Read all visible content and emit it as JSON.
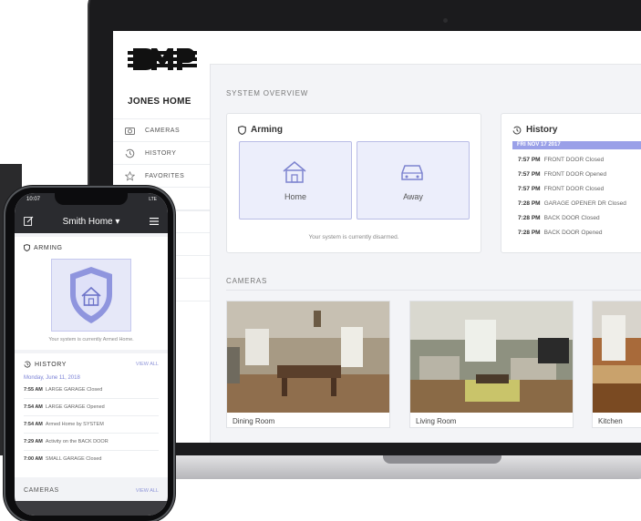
{
  "brand": {
    "logo_text": "DMP"
  },
  "sidebar": {
    "home_name": "JONES HOME",
    "items": [
      {
        "label": "CAMERAS",
        "icon": "camera-icon"
      },
      {
        "label": "HISTORY",
        "icon": "history-icon"
      },
      {
        "label": "FAVORITES",
        "icon": "star-icon"
      }
    ]
  },
  "main": {
    "system_overview_label": "SYSTEM OVERVIEW",
    "arming": {
      "title": "Arming",
      "buttons": [
        {
          "label": "Home",
          "icon": "house-icon"
        },
        {
          "label": "Away",
          "icon": "car-icon"
        }
      ],
      "status": "Your system is currently disarmed."
    },
    "history": {
      "title": "History",
      "date": "FRI NOV 17 2017",
      "events": [
        {
          "time": "7:57 PM",
          "text": "FRONT DOOR Closed"
        },
        {
          "time": "7:57 PM",
          "text": "FRONT DOOR Opened"
        },
        {
          "time": "7:57 PM",
          "text": "FRONT DOOR Closed"
        },
        {
          "time": "7:28 PM",
          "text": "GARAGE OPENER DR Closed"
        },
        {
          "time": "7:28 PM",
          "text": "BACK DOOR Closed"
        },
        {
          "time": "7:28 PM",
          "text": "BACK DOOR Opened"
        }
      ]
    },
    "cameras_label": "CAMERAS",
    "cameras": [
      {
        "name": "Dining Room"
      },
      {
        "name": "Living Room"
      },
      {
        "name": "Kitchen"
      }
    ]
  },
  "phone": {
    "time": "10:07",
    "signal": "LTE",
    "title": "Smith Home ▾",
    "arming_title": "ARMING",
    "arming_status": "Your system is currently Armed Home.",
    "history_title": "HISTORY",
    "view_all": "VIEW ALL",
    "date": "Monday, June 11, 2018",
    "events": [
      {
        "time": "7:55 AM",
        "text": "LARGE GARAGE Closed"
      },
      {
        "time": "7:54 AM",
        "text": "LARGE GARAGE Opened"
      },
      {
        "time": "7:54 AM",
        "text": "Armed Home by SYSTEM"
      },
      {
        "time": "7:29 AM",
        "text": "Activity on the BACK DOOR"
      },
      {
        "time": "7:00 AM",
        "text": "SMALL GARAGE Closed"
      }
    ],
    "cameras_title": "CAMERAS",
    "cameras_view_all": "VIEW ALL"
  },
  "colors": {
    "accent": "#9aa0e8",
    "accent_light": "#eceefb",
    "dark": "#1b1b1d"
  }
}
